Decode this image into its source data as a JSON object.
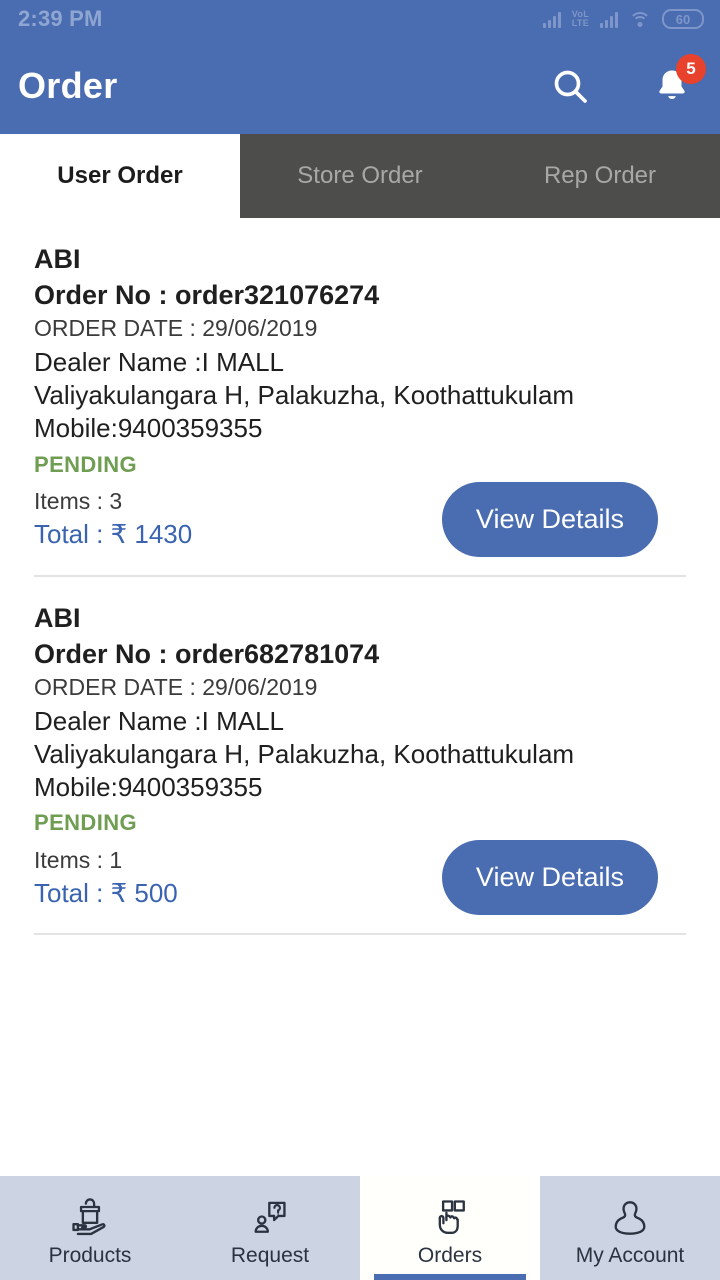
{
  "statusbar": {
    "time": "2:39 PM",
    "network_label": "VoLTE",
    "volte_top": "VoL",
    "volte_bottom": "LTE",
    "battery": "60",
    "icons": [
      "signal-bars-icon",
      "volte-icon",
      "signal-bars-icon",
      "wifi-icon",
      "battery-icon"
    ]
  },
  "appbar": {
    "title": "Order",
    "search_icon": "search-icon",
    "notification_icon": "bell-icon",
    "notification_count": "5",
    "background_color": "#4a6cb0"
  },
  "tabs": [
    {
      "label": "User Order",
      "active": true
    },
    {
      "label": "Store Order",
      "active": false
    },
    {
      "label": "Rep Order",
      "active": false
    }
  ],
  "orders": [
    {
      "customer": "ABI",
      "order_no": "Order No : order321076274",
      "order_date": "ORDER DATE : 29/06/2019",
      "dealer": "Dealer Name :I MALL",
      "address": "Valiyakulangara H, Palakuzha, Koothattukulam",
      "mobile": "Mobile:9400359355",
      "status": "PENDING",
      "items": "Items : 3",
      "total": "Total : ₹ 1430",
      "action_label": "View Details"
    },
    {
      "customer": "ABI",
      "order_no": "Order No : order682781074",
      "order_date": "ORDER DATE : 29/06/2019",
      "dealer": "Dealer Name :I MALL",
      "address": "Valiyakulangara H, Palakuzha, Koothattukulam",
      "mobile": "Mobile:9400359355",
      "status": "PENDING",
      "items": "Items : 1",
      "total": "Total : ₹ 500",
      "action_label": "View Details"
    }
  ],
  "bottomnav": [
    {
      "label": "Products",
      "icon": "hand-holding-bag-icon",
      "active": false
    },
    {
      "label": "Request",
      "icon": "person-question-icon",
      "active": false
    },
    {
      "label": "Orders",
      "icon": "hand-tap-tiles-icon",
      "active": true
    },
    {
      "label": "My Account",
      "icon": "person-icon",
      "active": false
    }
  ],
  "colors": {
    "primary_blue": "#4a6cb0",
    "status_green": "#6f9e52",
    "badge_red": "#e8412c",
    "tab_inactive_bg": "#4d4d4b",
    "nav_bg": "#ccd4e4"
  }
}
